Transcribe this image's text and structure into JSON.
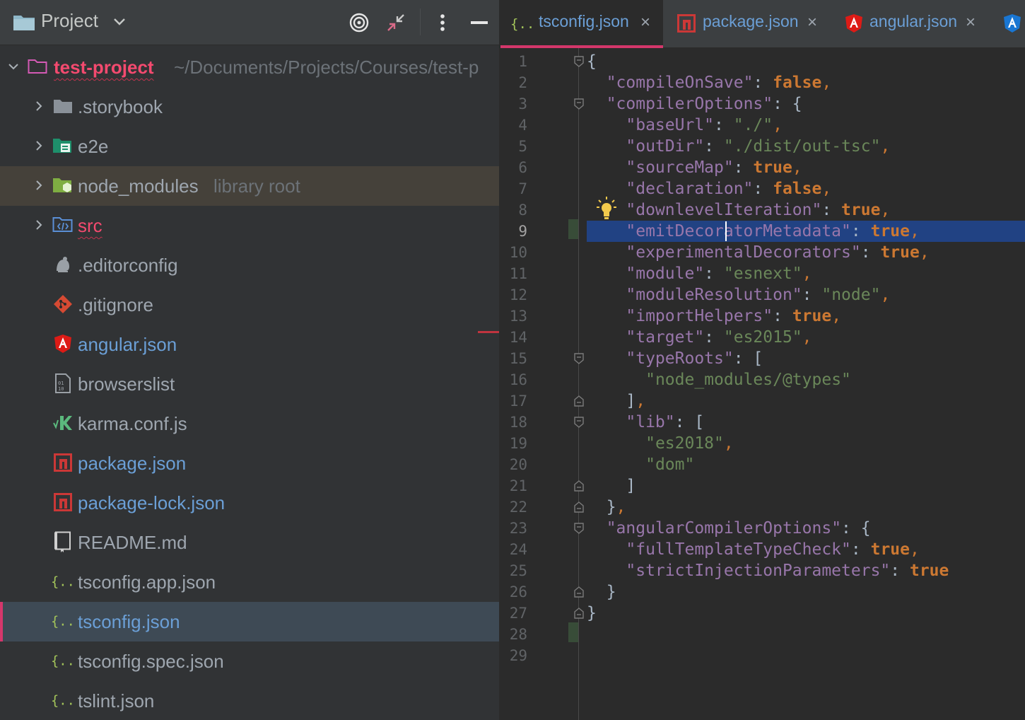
{
  "project": {
    "title": "Project",
    "tree": [
      {
        "label": "test-project",
        "hint": "~/Documents/Projects/Courses/test-p",
        "icon": "folder-icon",
        "expanded": true
      },
      {
        "label": ".storybook",
        "icon": "folder-icon"
      },
      {
        "label": "e2e",
        "icon": "test-folder-icon"
      },
      {
        "label": "node_modules",
        "hint": "library root",
        "icon": "library-folder-icon"
      },
      {
        "label": "src",
        "icon": "source-folder-icon"
      },
      {
        "label": ".editorconfig",
        "icon": "editorconfig-icon"
      },
      {
        "label": ".gitignore",
        "icon": "git-icon"
      },
      {
        "label": "angular.json",
        "icon": "angular-icon"
      },
      {
        "label": "browserslist",
        "icon": "text-file-icon"
      },
      {
        "label": "karma.conf.js",
        "icon": "karma-icon"
      },
      {
        "label": "package.json",
        "icon": "npm-icon"
      },
      {
        "label": "package-lock.json",
        "icon": "npm-icon"
      },
      {
        "label": "README.md",
        "icon": "readme-icon"
      },
      {
        "label": "tsconfig.app.json",
        "icon": "json-icon"
      },
      {
        "label": "tsconfig.json",
        "icon": "json-icon",
        "selected": true
      },
      {
        "label": "tsconfig.spec.json",
        "icon": "json-icon"
      },
      {
        "label": "tslint.json",
        "icon": "json-icon"
      }
    ]
  },
  "editor": {
    "tabs": [
      {
        "label": "tsconfig.json",
        "icon": "json-icon",
        "active": true
      },
      {
        "label": "package.json",
        "icon": "npm-icon"
      },
      {
        "label": "angular.json",
        "icon": "angular-icon"
      }
    ],
    "close_glyph": "×",
    "current_line": 9,
    "line_numbers": [
      "1",
      "2",
      "3",
      "4",
      "5",
      "6",
      "7",
      "8",
      "9",
      "10",
      "11",
      "12",
      "13",
      "14",
      "15",
      "16",
      "17",
      "18",
      "19",
      "20",
      "21",
      "22",
      "23",
      "24",
      "25",
      "26",
      "27",
      "28",
      "29"
    ],
    "code_lines": [
      [
        [
          "br",
          "{"
        ]
      ],
      [
        [
          "br",
          "  "
        ],
        [
          "k",
          "\"compileOnSave\""
        ],
        [
          "br",
          ": "
        ],
        [
          "b",
          "false"
        ],
        [
          "p",
          ","
        ]
      ],
      [
        [
          "br",
          "  "
        ],
        [
          "k",
          "\"compilerOptions\""
        ],
        [
          "br",
          ": {"
        ]
      ],
      [
        [
          "br",
          "    "
        ],
        [
          "k",
          "\"baseUrl\""
        ],
        [
          "br",
          ": "
        ],
        [
          "s",
          "\"./\""
        ],
        [
          "p",
          ","
        ]
      ],
      [
        [
          "br",
          "    "
        ],
        [
          "k",
          "\"outDir\""
        ],
        [
          "br",
          ": "
        ],
        [
          "s",
          "\"./dist/out-tsc\""
        ],
        [
          "p",
          ","
        ]
      ],
      [
        [
          "br",
          "    "
        ],
        [
          "k",
          "\"sourceMap\""
        ],
        [
          "br",
          ": "
        ],
        [
          "b",
          "true"
        ],
        [
          "p",
          ","
        ]
      ],
      [
        [
          "br",
          "    "
        ],
        [
          "k",
          "\"declaration\""
        ],
        [
          "br",
          ": "
        ],
        [
          "b",
          "false"
        ],
        [
          "p",
          ","
        ]
      ],
      [
        [
          "br",
          "    "
        ],
        [
          "k",
          "\"downlevelIteration\""
        ],
        [
          "br",
          ": "
        ],
        [
          "b",
          "true"
        ],
        [
          "p",
          ","
        ]
      ],
      [
        [
          "br",
          "    "
        ],
        [
          "k",
          "\"emitDecoratorMetadata\""
        ],
        [
          "br",
          ": "
        ],
        [
          "b",
          "true"
        ],
        [
          "p",
          ","
        ]
      ],
      [
        [
          "br",
          "    "
        ],
        [
          "k",
          "\"experimentalDecorators\""
        ],
        [
          "br",
          ": "
        ],
        [
          "b",
          "true"
        ],
        [
          "p",
          ","
        ]
      ],
      [
        [
          "br",
          "    "
        ],
        [
          "k",
          "\"module\""
        ],
        [
          "br",
          ": "
        ],
        [
          "s",
          "\"esnext\""
        ],
        [
          "p",
          ","
        ]
      ],
      [
        [
          "br",
          "    "
        ],
        [
          "k",
          "\"moduleResolution\""
        ],
        [
          "br",
          ": "
        ],
        [
          "s",
          "\"node\""
        ],
        [
          "p",
          ","
        ]
      ],
      [
        [
          "br",
          "    "
        ],
        [
          "k",
          "\"importHelpers\""
        ],
        [
          "br",
          ": "
        ],
        [
          "b",
          "true"
        ],
        [
          "p",
          ","
        ]
      ],
      [
        [
          "br",
          "    "
        ],
        [
          "k",
          "\"target\""
        ],
        [
          "br",
          ": "
        ],
        [
          "s",
          "\"es2015\""
        ],
        [
          "p",
          ","
        ]
      ],
      [
        [
          "br",
          "    "
        ],
        [
          "k",
          "\"typeRoots\""
        ],
        [
          "br",
          ": ["
        ]
      ],
      [
        [
          "br",
          "      "
        ],
        [
          "s",
          "\"node_modules/@types\""
        ]
      ],
      [
        [
          "br",
          "    ]"
        ],
        [
          "p",
          ","
        ]
      ],
      [
        [
          "br",
          "    "
        ],
        [
          "k",
          "\"lib\""
        ],
        [
          "br",
          ": ["
        ]
      ],
      [
        [
          "br",
          "      "
        ],
        [
          "s",
          "\"es2018\""
        ],
        [
          "p",
          ","
        ]
      ],
      [
        [
          "br",
          "      "
        ],
        [
          "s",
          "\"dom\""
        ]
      ],
      [
        [
          "br",
          "    ]"
        ]
      ],
      [
        [
          "br",
          "  }"
        ],
        [
          "p",
          ","
        ]
      ],
      [
        [
          "br",
          "  "
        ],
        [
          "k",
          "\"angularCompilerOptions\""
        ],
        [
          "br",
          ": {"
        ]
      ],
      [
        [
          "br",
          "    "
        ],
        [
          "k",
          "\"fullTemplateTypeCheck\""
        ],
        [
          "br",
          ": "
        ],
        [
          "b",
          "true"
        ],
        [
          "p",
          ","
        ]
      ],
      [
        [
          "br",
          "    "
        ],
        [
          "k",
          "\"strictInjectionParameters\""
        ],
        [
          "br",
          ": "
        ],
        [
          "b",
          "true"
        ]
      ],
      [
        [
          "br",
          "  }"
        ]
      ],
      [
        [
          "br",
          "}"
        ]
      ],
      [
        [
          "br",
          ""
        ]
      ],
      [
        [
          "br",
          ""
        ]
      ]
    ]
  },
  "colors": {
    "accent": "#d4376b",
    "selection": "#214283",
    "library_row": "#45413a",
    "selected_row": "#3e4a55"
  }
}
